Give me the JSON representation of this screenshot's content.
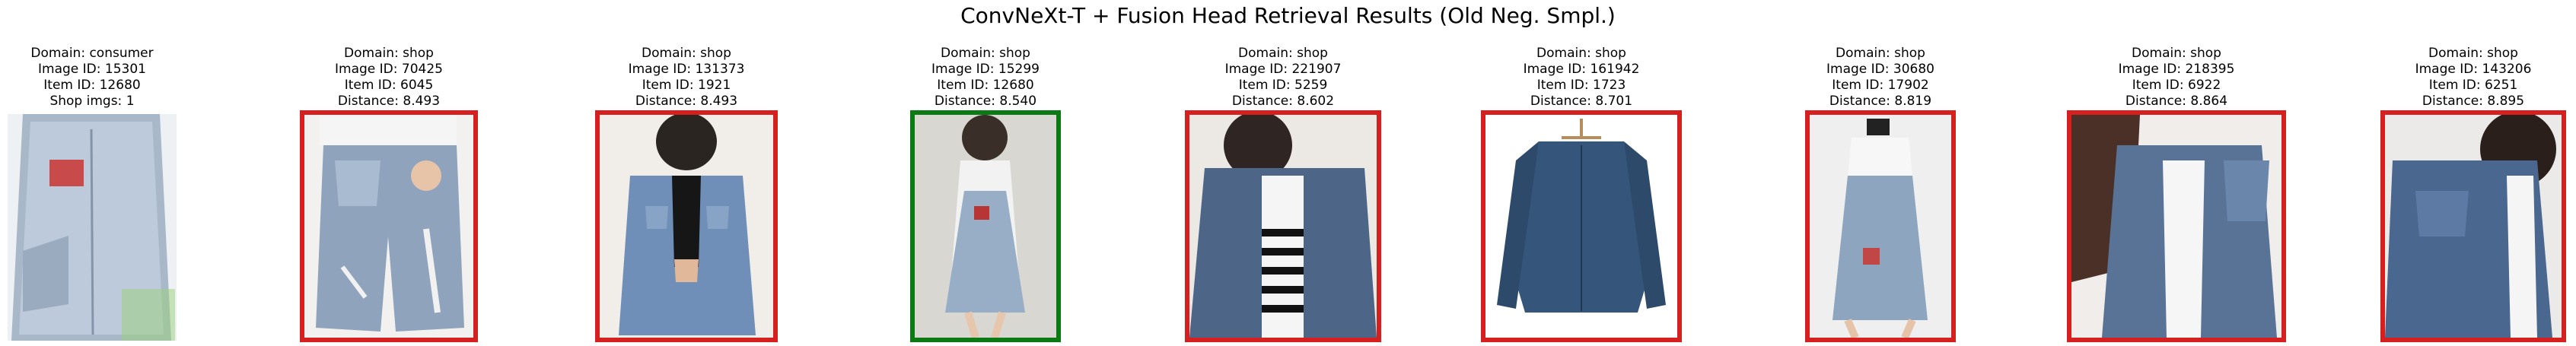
{
  "figure": {
    "title": "ConvNeXt-T + Fusion Head Retrieval Results (Old Neg. Smpl.)"
  },
  "query": {
    "domain": "Domain: consumer",
    "image_id": "Image ID: 15301",
    "item_id": "Item ID: 12680",
    "shop_imgs": "Shop imgs: 1",
    "photo": "denim-overall-dress-photo"
  },
  "results": [
    {
      "domain": "Domain: shop",
      "image_id": "Image ID: 70425",
      "item_id": "Item ID: 6045",
      "distance": "Distance: 8.493",
      "match": false,
      "border_color": "#d62020",
      "photo": "denim-shorts-photo"
    },
    {
      "domain": "Domain: shop",
      "image_id": "Image ID: 131373",
      "item_id": "Item ID: 1921",
      "distance": "Distance: 8.493",
      "match": false,
      "border_color": "#d62020",
      "photo": "denim-shirt-photo"
    },
    {
      "domain": "Domain: shop",
      "image_id": "Image ID: 15299",
      "item_id": "Item ID: 12680",
      "distance": "Distance: 8.540",
      "match": true,
      "border_color": "#0b7a14",
      "photo": "denim-overall-dress-photo"
    },
    {
      "domain": "Domain: shop",
      "image_id": "Image ID: 221907",
      "item_id": "Item ID: 5259",
      "distance": "Distance: 8.602",
      "match": false,
      "border_color": "#d62020",
      "photo": "denim-jacket-striped-shirt-photo"
    },
    {
      "domain": "Domain: shop",
      "image_id": "Image ID: 161942",
      "item_id": "Item ID: 1723",
      "distance": "Distance: 8.701",
      "match": false,
      "border_color": "#d62020",
      "photo": "denim-jacket-hanger-photo"
    },
    {
      "domain": "Domain: shop",
      "image_id": "Image ID: 30680",
      "item_id": "Item ID: 17902",
      "distance": "Distance: 8.819",
      "match": false,
      "border_color": "#d62020",
      "photo": "denim-overall-camera-photo"
    },
    {
      "domain": "Domain: shop",
      "image_id": "Image ID: 218395",
      "item_id": "Item ID: 6922",
      "distance": "Distance: 8.864",
      "match": false,
      "border_color": "#d62020",
      "photo": "denim-jacket-photo"
    },
    {
      "domain": "Domain: shop",
      "image_id": "Image ID: 143206",
      "item_id": "Item ID: 6251",
      "distance": "Distance: 8.895",
      "match": false,
      "border_color": "#d62020",
      "photo": "denim-jacket-photo"
    }
  ]
}
